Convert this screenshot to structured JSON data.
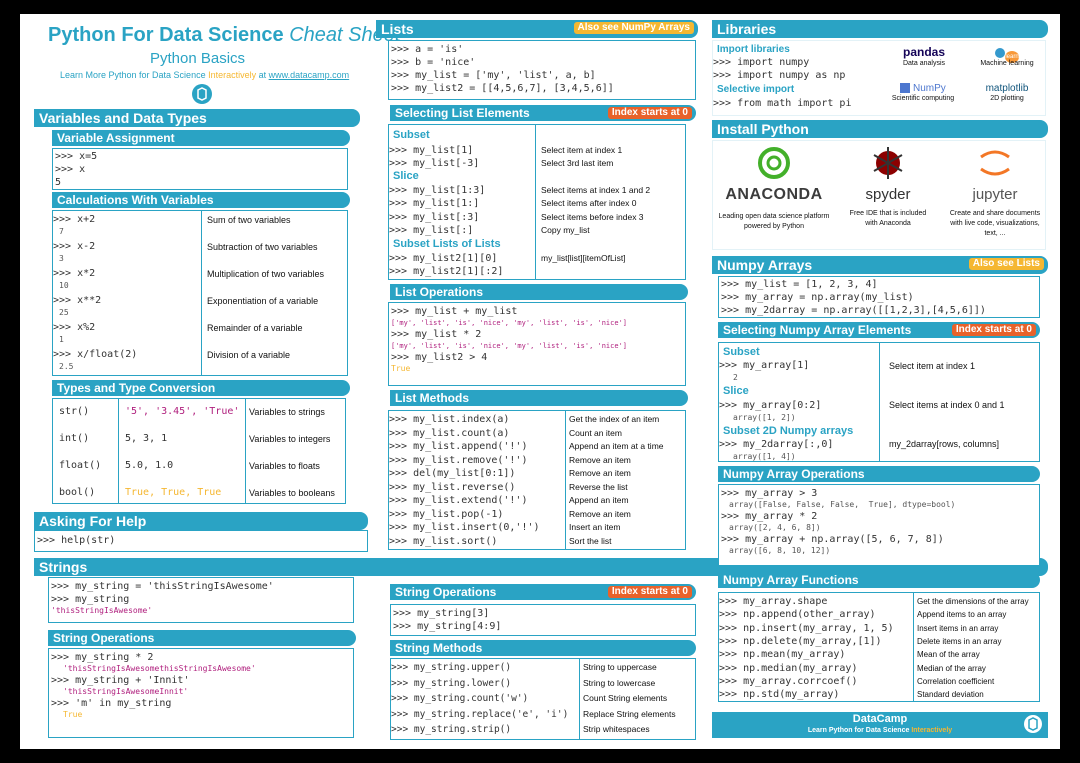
{
  "header": {
    "title": "Python For Data Science",
    "title_italic": "Cheat Sheet",
    "subtitle": "Python Basics",
    "learn_pre": "Learn More Python for Data Science ",
    "learn_mid": "Interactively",
    "learn_at": " at ",
    "url": "www.datacamp.com"
  },
  "variables": {
    "title": "Variables and Data Types",
    "assign_title": "Variable Assignment",
    "assign_code": ">>> x=5\n>>> x\n5",
    "calc_title": "Calculations With Variables",
    "calc_rows": [
      {
        "code": ">>> x+2",
        "out": "7",
        "desc": "Sum of two variables"
      },
      {
        "code": ">>> x-2",
        "out": "3",
        "desc": "Subtraction of two variables"
      },
      {
        "code": ">>> x*2",
        "out": "10",
        "desc": "Multiplication of two variables"
      },
      {
        "code": ">>> x**2",
        "out": "25",
        "desc": "Exponentiation of a variable"
      },
      {
        "code": ">>> x%2",
        "out": "1",
        "desc": "Remainder of a variable"
      },
      {
        "code": ">>> x/float(2)",
        "out": "2.5",
        "desc": "Division of a variable"
      }
    ],
    "types_title": "Types and Type Conversion",
    "types_rows": [
      {
        "fn": "str()",
        "ex": "'5', '3.45', 'True'",
        "desc": "Variables to strings"
      },
      {
        "fn": "int()",
        "ex": "5, 3, 1",
        "desc": "Variables to integers"
      },
      {
        "fn": "float()",
        "ex": "5.0, 1.0",
        "desc": "Variables to floats"
      },
      {
        "fn": "bool()",
        "ex": "True, True, True",
        "desc": "Variables to booleans"
      }
    ]
  },
  "help": {
    "title": "Asking For Help",
    "code": ">>> help(str)"
  },
  "strings": {
    "title": "Strings",
    "code": ">>> my_string = 'thisStringIsAwesome'\n>>> my_string",
    "out": "'thisStringIsAwesome'",
    "ops_title": "String Operations",
    "ops_code1": ">>> my_string * 2",
    "ops_out1": "'thisStringIsAwesomethisStringIsAwesome'",
    "ops_code2": ">>> my_string + 'Innit'",
    "ops_out2": "'thisStringIsAwesomeInnit'",
    "ops_code3": ">>> 'm' in my_string",
    "ops_out3": "True",
    "ops2_title": "String Operations",
    "ops2_tag": "Index starts at 0",
    "ops2_code": ">>> my_string[3]\n>>> my_string[4:9]",
    "methods_title": "String Methods",
    "methods": [
      {
        "code": ">>> my_string.upper()",
        "desc": "String to uppercase"
      },
      {
        "code": ">>> my_string.lower()",
        "desc": "String to lowercase"
      },
      {
        "code": ">>> my_string.count('w')",
        "desc": "Count String elements"
      },
      {
        "code": ">>> my_string.replace('e', 'i')",
        "desc": "Replace String elements"
      },
      {
        "code": ">>> my_string.strip()",
        "desc": "Strip whitespaces"
      }
    ]
  },
  "lists": {
    "title": "Lists",
    "tag": "Also see NumPy Arrays",
    "code": ">>> a = 'is'\n>>> b = 'nice'\n>>> my_list = ['my', 'list', a, b]\n>>> my_list2 = [[4,5,6,7], [3,4,5,6]]",
    "sel_title": "Selecting List Elements",
    "sel_tag": "Index starts at 0",
    "subset": "Subset",
    "slice": "Slice",
    "sublists": "Subset Lists of Lists",
    "sel_rows": [
      {
        "code": ">>> my_list[1]",
        "desc": "Select item at index 1"
      },
      {
        "code": ">>> my_list[-3]",
        "desc": "Select 3rd last item"
      },
      {
        "code": ">>> my_list[1:3]",
        "desc": "Select items at index 1 and 2"
      },
      {
        "code": ">>> my_list[1:]",
        "desc": "Select items after index 0"
      },
      {
        "code": ">>> my_list[:3]",
        "desc": "Select items before index 3"
      },
      {
        "code": ">>> my_list[:]",
        "desc": "Copy my_list"
      },
      {
        "code": ">>> my_list2[1][0]",
        "desc": "my_list[list][itemOfList]"
      },
      {
        "code": ">>> my_list2[1][:2]",
        "desc": ""
      }
    ],
    "ops_title": "List Operations",
    "ops_code1": ">>> my_list + my_list",
    "ops_out1": "['my', 'list', 'is', 'nice', 'my', 'list', 'is', 'nice']",
    "ops_code2": ">>> my_list * 2",
    "ops_out2": "['my', 'list', 'is', 'nice', 'my', 'list', 'is', 'nice']",
    "ops_code3": ">>> my_list2 > 4",
    "ops_out3": "True",
    "methods_title": "List Methods",
    "methods": [
      {
        "code": ">>> my_list.index(a)",
        "desc": "Get the index of an item"
      },
      {
        "code": ">>> my_list.count(a)",
        "desc": "Count an item"
      },
      {
        "code": ">>> my_list.append('!')",
        "desc": "Append an item at a time"
      },
      {
        "code": ">>> my_list.remove('!')",
        "desc": "Remove an item"
      },
      {
        "code": ">>> del(my_list[0:1])",
        "desc": "Remove an item"
      },
      {
        "code": ">>> my_list.reverse()",
        "desc": "Reverse the list"
      },
      {
        "code": ">>> my_list.extend('!')",
        "desc": "Append an item"
      },
      {
        "code": ">>> my_list.pop(-1)",
        "desc": "Remove an item"
      },
      {
        "code": ">>> my_list.insert(0,'!')",
        "desc": "Insert an item"
      },
      {
        "code": ">>> my_list.sort()",
        "desc": "Sort the list"
      }
    ]
  },
  "libraries": {
    "title": "Libraries",
    "import_title": "Import libraries",
    "import_code": ">>> import numpy\n>>> import numpy as np",
    "sel_title": "Selective import",
    "sel_code": ">>> from math import pi",
    "logos": [
      {
        "name": "pandas",
        "label": "Data analysis"
      },
      {
        "name": "learn",
        "label": "Machine learning"
      },
      {
        "name": "NumPy",
        "label": "Scientific computing"
      },
      {
        "name": "matplotlib",
        "label": "2D plotting"
      }
    ]
  },
  "install": {
    "title": "Install Python",
    "items": [
      {
        "name": "ANACONDA",
        "desc": "Leading open data science platform powered by Python"
      },
      {
        "name": "spyder",
        "desc": "Free IDE that is included with Anaconda"
      },
      {
        "name": "jupyter",
        "desc": "Create and share documents with live code, visualizations, text, ..."
      }
    ]
  },
  "numpy": {
    "title": "Numpy Arrays",
    "tag": "Also see Lists",
    "code": ">>> my_list = [1, 2, 3, 4]\n>>> my_array = np.array(my_list)\n>>> my_2darray = np.array([[1,2,3],[4,5,6]])",
    "sel_title": "Selecting Numpy Array Elements",
    "sel_tag": "Index starts at 0",
    "subset": "Subset",
    "subset_code": ">>> my_array[1]",
    "subset_out": "2",
    "subset_desc": "Select item at index 1",
    "slice": "Slice",
    "slice_code": ">>> my_array[0:2]",
    "slice_out": "array([1, 2])",
    "slice_desc": "Select items at index 0 and 1",
    "sub2d": "Subset 2D Numpy arrays",
    "sub2d_code": ">>> my_2darray[:,0]",
    "sub2d_out": "array([1, 4])",
    "sub2d_desc": "my_2darray[rows, columns]",
    "ops_title": "Numpy Array Operations",
    "ops_code1": ">>> my_array > 3",
    "ops_out1": "array([False, False, False,  True], dtype=bool)",
    "ops_code2": ">>> my_array * 2",
    "ops_out2": "array([2, 4, 6, 8])",
    "ops_code3": ">>> my_array + np.array([5, 6, 7, 8])",
    "ops_out3": "array([6, 8, 10, 12])",
    "fn_title": "Numpy Array Functions",
    "fns": [
      {
        "code": ">>> my_array.shape",
        "desc": "Get the dimensions of the array"
      },
      {
        "code": ">>> np.append(other_array)",
        "desc": "Append items to an array"
      },
      {
        "code": ">>> np.insert(my_array, 1, 5)",
        "desc": "Insert items in an array"
      },
      {
        "code": ">>> np.delete(my_array,[1])",
        "desc": "Delete items in an array"
      },
      {
        "code": ">>> np.mean(my_array)",
        "desc": "Mean of the array"
      },
      {
        "code": ">>> np.median(my_array)",
        "desc": "Median of the array"
      },
      {
        "code": ">>> my_array.corrcoef()",
        "desc": "Correlation coefficient"
      },
      {
        "code": ">>> np.std(my_array)",
        "desc": "Standard deviation"
      }
    ]
  },
  "footer": {
    "brand": "DataCamp",
    "tagline_pre": "Learn Python for Data Science ",
    "tagline_em": "Interactively"
  },
  "colors": {
    "accent": "#2aa3c4",
    "tag_yellow": "#f5b731",
    "tag_orange": "#e8622a",
    "string": "#b0207e"
  }
}
